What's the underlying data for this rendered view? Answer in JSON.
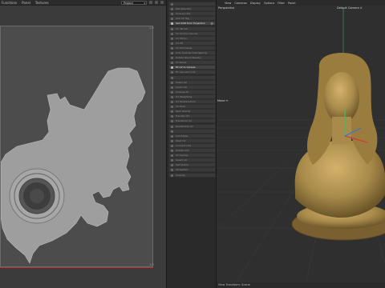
{
  "uv_editor": {
    "menu": [
      "Functions",
      "Panel",
      "Textures"
    ],
    "mode_select": "Project",
    "axis_labels": {
      "top_right": "1.0",
      "bottom_right": "1.0"
    }
  },
  "command_list": {
    "items": [
      {
        "label": "",
        "active": false
      },
      {
        "label": "Set Selected",
        "active": false
      },
      {
        "label": "Unwrap UVs",
        "active": false
      },
      {
        "label": "Add UV Tag",
        "active": false
      },
      {
        "label": "Set UVW from Projection",
        "active": true
      },
      {
        "label": "UV Terrain",
        "active": false
      },
      {
        "label": "UV Grid to Canvas",
        "active": false
      },
      {
        "label": "UV Mirror",
        "active": false
      },
      {
        "label": "UV Fill",
        "active": false
      },
      {
        "label": "UV Normalize",
        "active": false
      },
      {
        "label": "Auto Unwrap Overlapping",
        "active": false
      },
      {
        "label": "Rotate Island Nearby",
        "active": false
      },
      {
        "label": "UV Relax",
        "active": false
      },
      {
        "label": "Fit UV to Canvas",
        "active": true
      },
      {
        "label": "Fit Canvas to UV",
        "active": false
      },
      {
        "label": "",
        "active": false
      },
      {
        "label": "Select All",
        "active": false
      },
      {
        "label": "Invert UV",
        "active": false
      },
      {
        "label": "Unwrap All",
        "active": false
      },
      {
        "label": "UV Weighting",
        "active": false
      },
      {
        "label": "UV Re-Transform",
        "active": false
      },
      {
        "label": "UV Pack",
        "active": false
      },
      {
        "label": "Pack Islands",
        "active": false
      },
      {
        "label": "Transfer UV",
        "active": false
      },
      {
        "label": "Transform UV",
        "active": false
      },
      {
        "label": "Randomize UV",
        "active": false
      },
      {
        "label": "",
        "active": false
      },
      {
        "label": "Cut Edges",
        "active": false
      },
      {
        "label": "Weld UV",
        "active": false
      },
      {
        "label": "Connect UVs",
        "active": false
      },
      {
        "label": "Isolate UVs",
        "active": false
      },
      {
        "label": "UV Seams",
        "active": false
      },
      {
        "label": "Select All",
        "active": false
      },
      {
        "label": "Set Seams",
        "active": false
      },
      {
        "label": "Straighten",
        "active": false
      },
      {
        "label": "Unwrap",
        "active": false
      }
    ]
  },
  "viewport": {
    "menu": [
      "View",
      "Cameras",
      "Display",
      "Options",
      "Filter",
      "Panel"
    ],
    "view_name": "Perspective",
    "camera_label": "Default Camera ⊙",
    "move_label": "Move ↔",
    "status": "View Transform: Scene"
  },
  "colors": {
    "accent_red": "#b33333",
    "bust_gold": "#a88a4a",
    "uv_mesh": "#9c9c9c"
  }
}
